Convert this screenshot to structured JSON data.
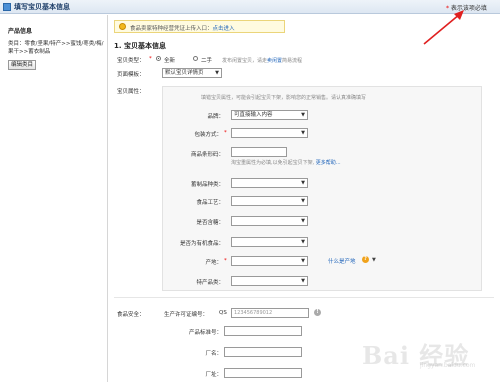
{
  "titlebar": {
    "title": "填写宝贝基本信息",
    "required_note": "表示该项必填",
    "required_star": "*"
  },
  "sidebar": {
    "title": "产品信息",
    "category": "类目：零食/坚果/特产>>蜜饯/枣类/梅/果干>>蓄衣制品",
    "edit_button": "编辑类目"
  },
  "notice": {
    "text": "食品卖家特种经营凭证上传入口：",
    "link": "点击进入"
  },
  "section": {
    "title": "1. 宝贝基本信息"
  },
  "item_type": {
    "label": "宝贝类型：",
    "options": [
      "全新",
      "二手"
    ],
    "selected": "全新",
    "hint": "发布闲置宝贝，请走",
    "hint_link": "卖闲置",
    "hint_tail": "简易流程"
  },
  "template": {
    "label": "页面模板：",
    "value": "默认宝贝详情页"
  },
  "attrs": {
    "label": "宝贝属性：",
    "hint": "填错宝贝属性，可能会引起宝贝下架，影响您的正常销售。请认真准确填写",
    "brand": {
      "label": "品牌：",
      "value": "可直接输入内容"
    },
    "packaging": {
      "label": "包装方式："
    },
    "barcode": {
      "label": "商品条形码：",
      "hint": "淘宝重属性为必填,以免引起宝贝下架",
      "link": "更多帮助..."
    },
    "preserved_type": {
      "label": "蓄制品种类："
    },
    "process": {
      "label": "食品工艺："
    },
    "sugar": {
      "label": "是否含糖："
    },
    "organic": {
      "label": "是否为有机食品："
    },
    "origin": {
      "label": "产地：",
      "link": "什么是产地"
    },
    "specialty": {
      "label": "特产品类："
    }
  },
  "food_safety": {
    "label": "食品安全：",
    "license": {
      "label": "生产许可证编号：",
      "prefix": "QS",
      "placeholder": "123456789012"
    },
    "standard": {
      "label": "产品标准号："
    },
    "factory": {
      "label": "厂名："
    },
    "address": {
      "label": "厂址："
    }
  },
  "watermark": {
    "text": "Bai 经验",
    "sub": "jingyan.baidu.com"
  },
  "colors": {
    "accent": "#2266bb",
    "required": "#e00000",
    "arrow": "#e02020"
  }
}
